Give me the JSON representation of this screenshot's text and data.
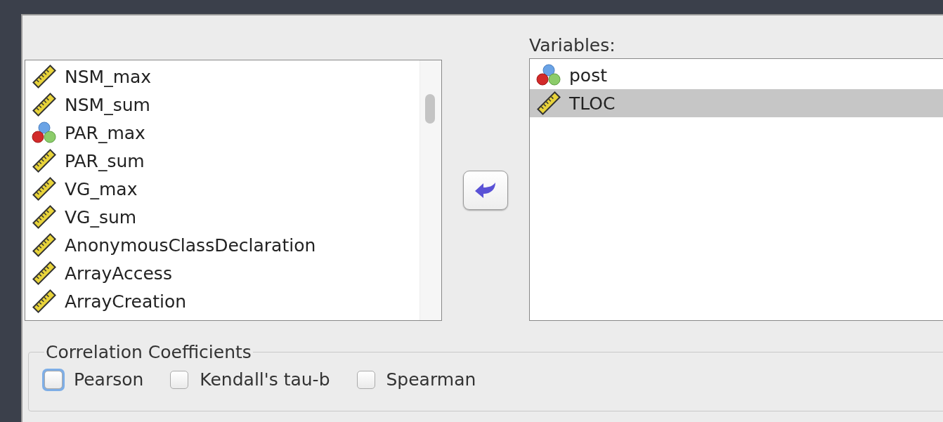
{
  "source_list": {
    "items": [
      {
        "label": "NSM_max",
        "kind": "scale",
        "selected": false
      },
      {
        "label": "NSM_sum",
        "kind": "scale",
        "selected": false
      },
      {
        "label": "PAR_max",
        "kind": "nominal",
        "selected": false
      },
      {
        "label": "PAR_sum",
        "kind": "scale",
        "selected": false
      },
      {
        "label": "VG_max",
        "kind": "scale",
        "selected": false
      },
      {
        "label": "VG_sum",
        "kind": "scale",
        "selected": false
      },
      {
        "label": "AnonymousClassDeclaration",
        "kind": "scale",
        "selected": false
      },
      {
        "label": "ArrayAccess",
        "kind": "scale",
        "selected": false
      },
      {
        "label": "ArrayCreation",
        "kind": "scale",
        "selected": false
      }
    ]
  },
  "variables": {
    "label": "Variables:",
    "items": [
      {
        "label": "post",
        "kind": "nominal",
        "selected": false
      },
      {
        "label": "TLOC",
        "kind": "scale",
        "selected": true
      }
    ]
  },
  "correlation_coefficients": {
    "title": "Correlation Coefficients",
    "options": [
      {
        "label": "Pearson",
        "checked": false,
        "focused": true
      },
      {
        "label": "Kendall's tau-b",
        "checked": false,
        "focused": false
      },
      {
        "label": "Spearman",
        "checked": false,
        "focused": false
      }
    ]
  }
}
